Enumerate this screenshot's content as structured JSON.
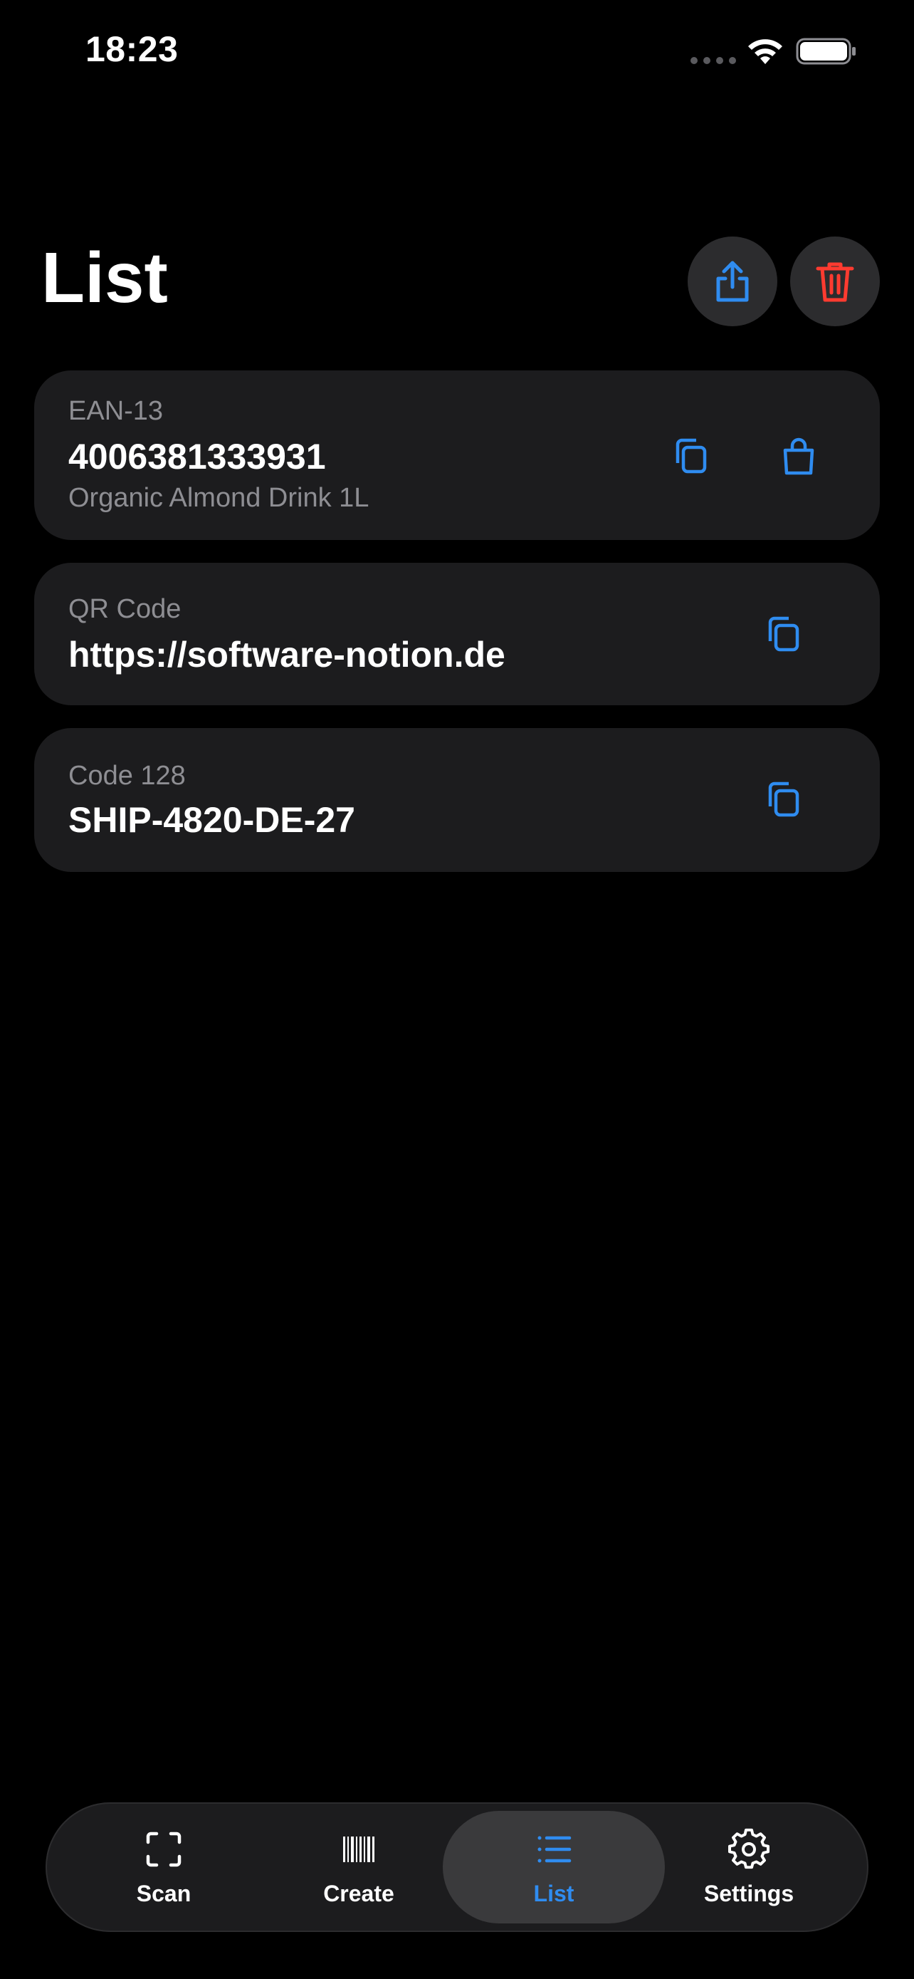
{
  "status_bar": {
    "time": "18:23"
  },
  "header": {
    "title": "List",
    "share_icon": "share-icon",
    "trash_icon": "trash-icon"
  },
  "colors": {
    "accent": "#2f8cf0",
    "danger": "#ff3b30",
    "card_background": "#1c1c1e",
    "secondary_text": "#8e8e93"
  },
  "items": [
    {
      "type": "EAN-13",
      "value": "4006381333931",
      "description": "Organic Almond Drink 1L",
      "actions": [
        "copy-icon",
        "shopping-bag-icon"
      ]
    },
    {
      "type": "QR Code",
      "value": "https://software-notion.de",
      "actions": [
        "copy-icon"
      ]
    },
    {
      "type": "Code 128",
      "value": "SHIP-4820-DE-27",
      "actions": [
        "copy-icon"
      ]
    }
  ],
  "tab_bar": {
    "tabs": [
      {
        "label": "Scan",
        "icon": "scan-icon",
        "active": false
      },
      {
        "label": "Create",
        "icon": "barcode-icon",
        "active": false
      },
      {
        "label": "List",
        "icon": "list-icon",
        "active": true
      },
      {
        "label": "Settings",
        "icon": "gear-icon",
        "active": false
      }
    ]
  }
}
